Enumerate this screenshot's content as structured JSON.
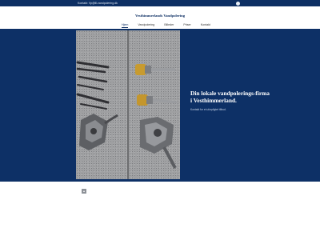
{
  "topbar": {
    "contact": "Kontakt: Vp@ill-vandpolering.dk",
    "social_icon": "facebook-icon"
  },
  "header": {
    "brand": "Vesthimmerlands Vandpolering"
  },
  "nav": {
    "items": [
      "Hjem",
      "Vandpolering",
      "Billeder",
      "Priser",
      "Kontakt"
    ],
    "active": "Hjem"
  },
  "hero": {
    "heading": "Din lokale vandpolerings-firma i Vesthimmerland.",
    "subtext": "Kontakt for et uforpligtet tilbud.",
    "image": "polishing-tools-on-granite-photo"
  },
  "colors": {
    "primary": "#0d3066",
    "topbar": "#0d2f63",
    "background": "#ffffff"
  },
  "scroll_top_icon": "arrow-up-icon"
}
